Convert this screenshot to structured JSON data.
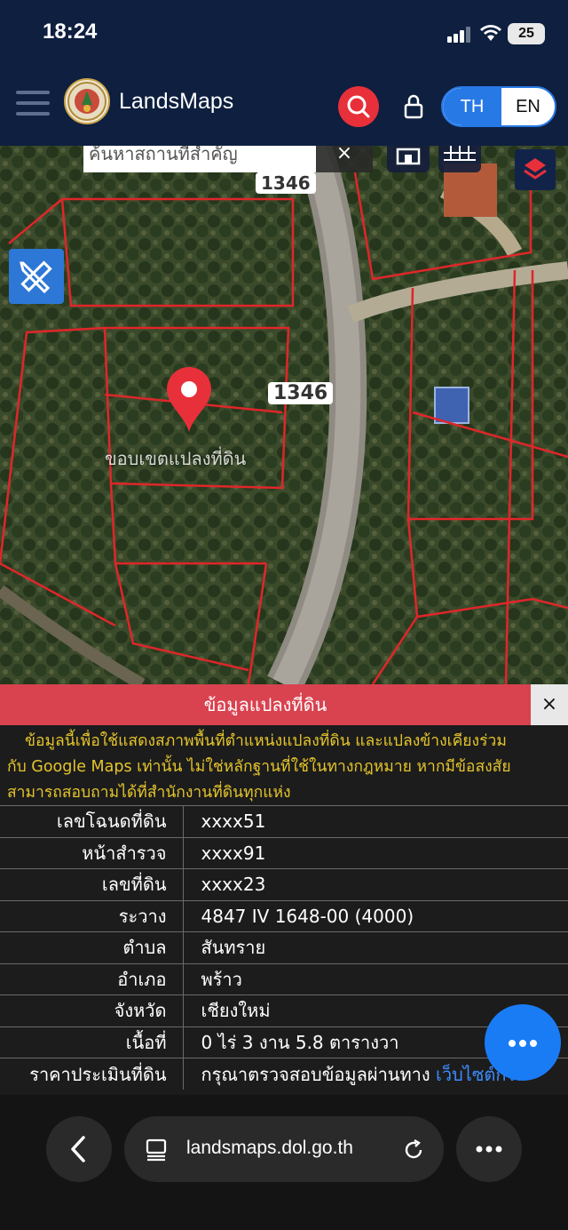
{
  "status_bar": {
    "time": "18:24",
    "battery": "25"
  },
  "header": {
    "app_title": "LandsMaps",
    "lang_th": "TH",
    "lang_en": "EN"
  },
  "map": {
    "search_placeholder": "ค้นหาสถานที่สำคัญ",
    "clear_label": "×",
    "road_labels": [
      "1346",
      "1346"
    ],
    "parcel_label": "ขอบเขตแปลงที่ดิน"
  },
  "panel": {
    "title": "ข้อมูลแปลงที่ดิน",
    "close_label": "×",
    "disclaimer": [
      "ข้อมูลนี้เพื่อใช้แสดงสภาพพื้นที่ตำแหน่งแปลงที่ดิน และแปลงข้างเคียงร่วม",
      "กับ Google Maps เท่านั้น ไม่ใช่หลักฐานที่ใช้ในทางกฎหมาย หากมีข้อสงสัย",
      "สามารถสอบถามได้ที่สำนักงานที่ดินทุกแห่ง"
    ],
    "rows": [
      {
        "label": "เลขโฉนดที่ดิน",
        "value": "xxxx51"
      },
      {
        "label": "หน้าสำรวจ",
        "value": "xxxx91"
      },
      {
        "label": "เลขที่ดิน",
        "value": "xxxx23"
      },
      {
        "label": "ระวาง",
        "value": "4847 IV 1648-00 (4000)"
      },
      {
        "label": "ตำบล",
        "value": "สันทราย"
      },
      {
        "label": "อำเภอ",
        "value": "พร้าว"
      },
      {
        "label": "จังหวัด",
        "value": "เชียงใหม่"
      },
      {
        "label": "เนื้อที่",
        "value": "0 ไร่ 3 งาน 5.8 ตารางวา"
      },
      {
        "label": "ราคาประเมินที่ดิน",
        "value": "กรุณาตรวจสอบข้อมูลผ่านทาง",
        "link": "เว็บไซต์กรม"
      }
    ]
  },
  "browser": {
    "url": "landsmaps.dol.go.th"
  },
  "colors": {
    "header_bg": "#0e1f3f",
    "accent_red": "#d9424f",
    "accent_blue": "#2779e6",
    "disclaimer_yellow": "#e5c52b",
    "link_blue": "#3b8cff"
  },
  "icons": [
    "signal-icon",
    "wifi-icon",
    "hamburger-icon",
    "search-icon",
    "lock-icon",
    "building-icon",
    "grid-icon",
    "layers-icon",
    "ruler-pencil-icon",
    "location-pin-icon",
    "more-horizontal-icon",
    "chevron-left-icon",
    "tabs-icon",
    "reload-icon"
  ]
}
